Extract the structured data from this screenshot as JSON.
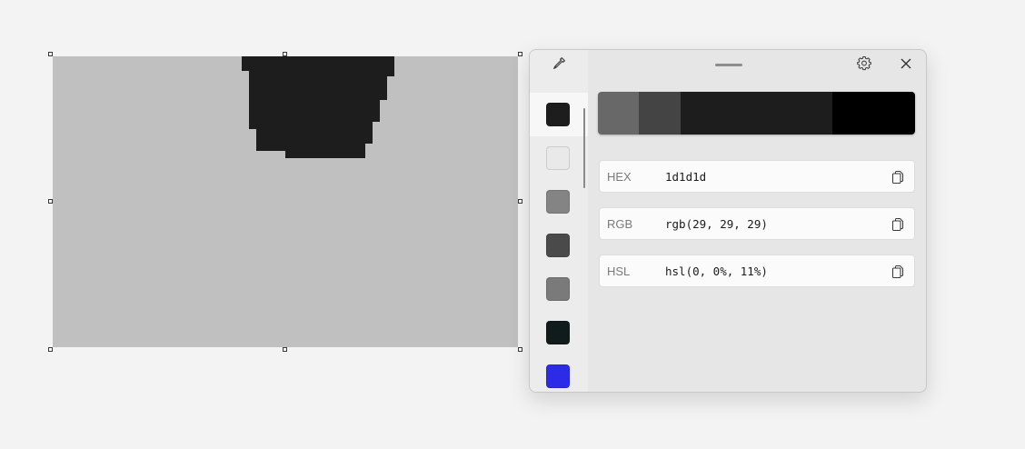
{
  "canvas": {
    "background_color": "#c0c0c0",
    "shape_color": "#1d1d1d"
  },
  "picker": {
    "history": [
      {
        "name": "dark-gray",
        "color": "#1d1d1d",
        "selected": true
      },
      {
        "name": "light-gray",
        "color": "#e9e9e9",
        "selected": false
      },
      {
        "name": "medium-gray",
        "color": "#848484",
        "selected": false
      },
      {
        "name": "charcoal",
        "color": "#4a4a4a",
        "selected": false
      },
      {
        "name": "gray",
        "color": "#7a7a7a",
        "selected": false
      },
      {
        "name": "near-black-teal",
        "color": "#101c1c",
        "selected": false
      },
      {
        "name": "blue",
        "color": "#2c2ce8",
        "selected": false
      }
    ],
    "shades": [
      {
        "color": "#686868",
        "share": 0.13
      },
      {
        "color": "#444444",
        "share": 0.13
      },
      {
        "color": "#1d1d1d",
        "share": 0.48
      },
      {
        "color": "#000000",
        "share": 0.26
      }
    ],
    "values": [
      {
        "label": "HEX",
        "value": "1d1d1d"
      },
      {
        "label": "RGB",
        "value": "rgb(29, 29, 29)"
      },
      {
        "label": "HSL",
        "value": "hsl(0, 0%, 11%)"
      }
    ],
    "icons": {
      "eyedropper": "eyedropper-icon",
      "settings": "gear-icon",
      "close": "close-icon",
      "copy": "copy-icon"
    }
  }
}
